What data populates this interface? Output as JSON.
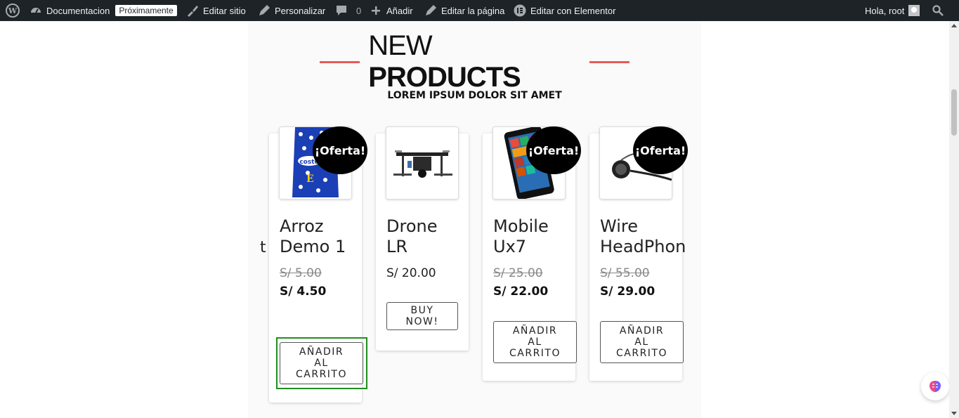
{
  "adminbar": {
    "site": "Documentacion",
    "badge": "Próximamente",
    "edit_site": "Editar sitio",
    "customize": "Personalizar",
    "comments_count": "0",
    "add": "Añadir",
    "edit_page": "Editar la página",
    "elementor": "Editar con Elementor",
    "greeting": "Hola, root"
  },
  "section": {
    "title_light": "NEW",
    "title_bold": "PRODUCTS",
    "subtitle": "LOREM IPSUM DOLOR SIT AMET"
  },
  "partial_text": "t",
  "products": [
    {
      "name_line1": "Arroz",
      "name_line2": "Demo 1",
      "old_price": "S/ 5.00",
      "price": "S/ 4.50",
      "button": [
        "AÑADIR",
        "AL",
        "CARRITO"
      ],
      "sale": "¡Oferta!"
    },
    {
      "name_line1": "Drone",
      "name_line2": "LR",
      "price": "S/ 20.00",
      "button": [
        "BUY",
        "NOW!"
      ]
    },
    {
      "name_line1": "Mobile",
      "name_line2": "Ux7",
      "old_price": "S/ 25.00",
      "price": "S/ 22.00",
      "button": [
        "AÑADIR",
        "AL",
        "CARRITO"
      ],
      "sale": "¡Oferta!"
    },
    {
      "name_line1": "Wire",
      "name_line2": "HeadPhon",
      "old_price": "S/ 55.00",
      "price": "S/ 29.00",
      "button": [
        "AÑADIR",
        "AL",
        "CARRITO"
      ],
      "sale": "¡Oferta!"
    }
  ],
  "colors": {
    "accent_line": "#e85a5a",
    "focus": "#1e8f1e",
    "adminbar": "#1d2327"
  }
}
